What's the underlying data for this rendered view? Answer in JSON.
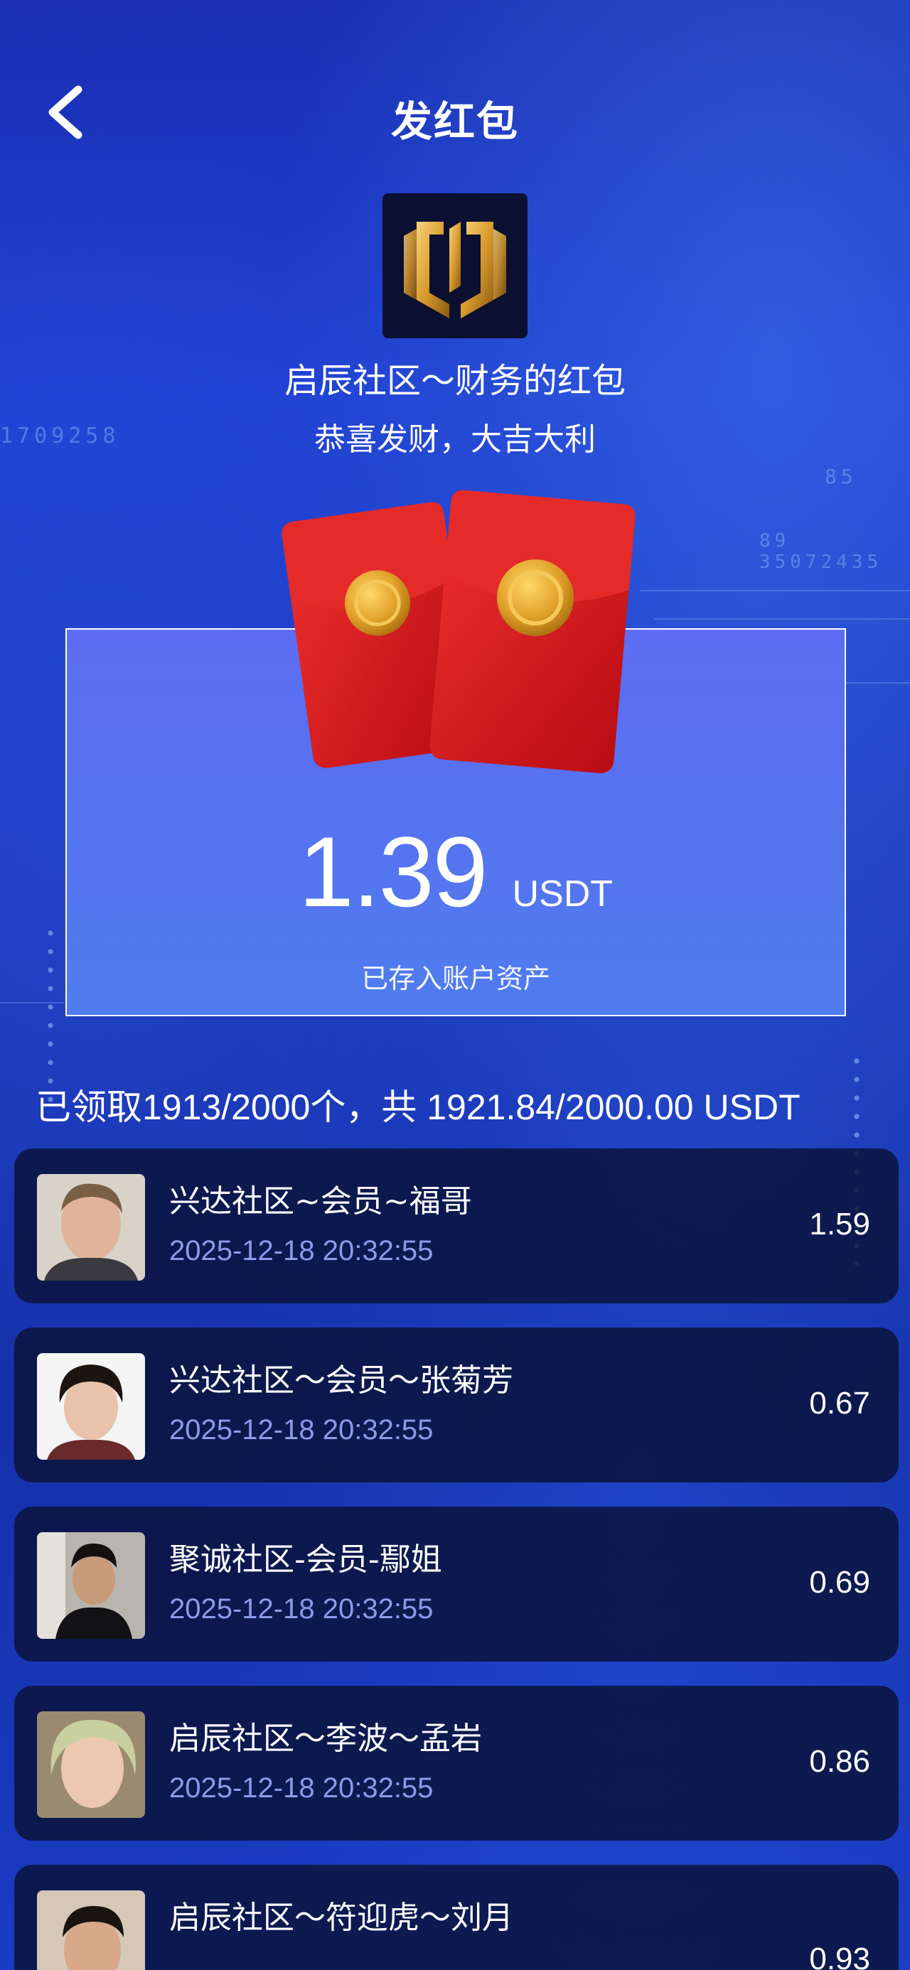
{
  "header": {
    "title": "发红包",
    "back_icon": "chevron-left-icon"
  },
  "packet": {
    "sender": "启辰社区～财务的红包",
    "greeting": "恭喜发财，大吉大利",
    "amount": "1.39",
    "unit": "USDT",
    "note": "已存入账户资产"
  },
  "summary": "已领取1913/2000个，共 1921.84/2000.00 USDT",
  "claims": [
    {
      "name": "兴达社区~会员~福哥",
      "time": "2025-12-18 20:32:55",
      "amount": "1.59"
    },
    {
      "name": "兴达社区～会员～张菊芳",
      "time": "2025-12-18 20:32:55",
      "amount": "0.67"
    },
    {
      "name": "聚诚社区-会员-鄢姐",
      "time": "2025-12-18 20:32:55",
      "amount": "0.69"
    },
    {
      "name": "启辰社区～李波～孟岩",
      "time": "2025-12-18 20:32:55",
      "amount": "0.86"
    },
    {
      "name": "启辰社区～符迎虎～刘月",
      "time": "",
      "amount": "0.93"
    }
  ],
  "colors": {
    "background": "#1f3fd0",
    "card_top": "#5d6cf2",
    "card_bottom": "#4f7cee",
    "envelope_red": "#d8141a",
    "coin_gold": "#e2a72a",
    "time_text": "#8c9be8",
    "list_bg": "#0a1237"
  }
}
